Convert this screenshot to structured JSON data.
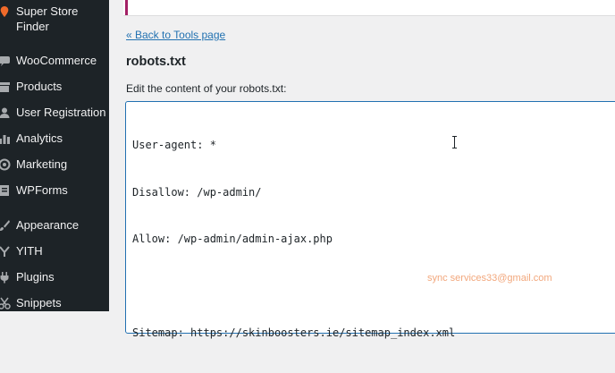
{
  "sidebar": {
    "items": [
      {
        "label": "Super Store Finder",
        "icon": "store-pin-icon"
      },
      {
        "label": "WooCommerce",
        "icon": "woo-bubble-icon"
      },
      {
        "label": "Products",
        "icon": "archive-box-icon"
      },
      {
        "label": "User Registration",
        "icon": "user-icon"
      },
      {
        "label": "Analytics",
        "icon": "bar-chart-icon"
      },
      {
        "label": "Marketing",
        "icon": "megaphone-icon"
      },
      {
        "label": "WPForms",
        "icon": "form-icon"
      },
      {
        "label": "Appearance",
        "icon": "paintbrush-icon"
      },
      {
        "label": "YITH",
        "icon": "yith-icon"
      },
      {
        "label": "Plugins",
        "icon": "plug-icon"
      },
      {
        "label": "Snippets",
        "icon": "scissors-icon"
      }
    ]
  },
  "main": {
    "back_link": "« Back to Tools page",
    "title": "robots.txt",
    "description": "Edit the content of your robots.txt:",
    "editor_lines": [
      "User-agent: *",
      "Disallow: /wp-admin/",
      "Allow: /wp-admin/admin-ajax.php",
      "",
      "Sitemap: https://skinboosters.ie/sitemap_index.xml"
    ]
  },
  "watermark": "sync services33@gmail.com",
  "colors": {
    "sidebar_bg": "#1d2327",
    "link": "#2271b1",
    "accent": "#a32065",
    "watermark": "#f2a77c"
  }
}
